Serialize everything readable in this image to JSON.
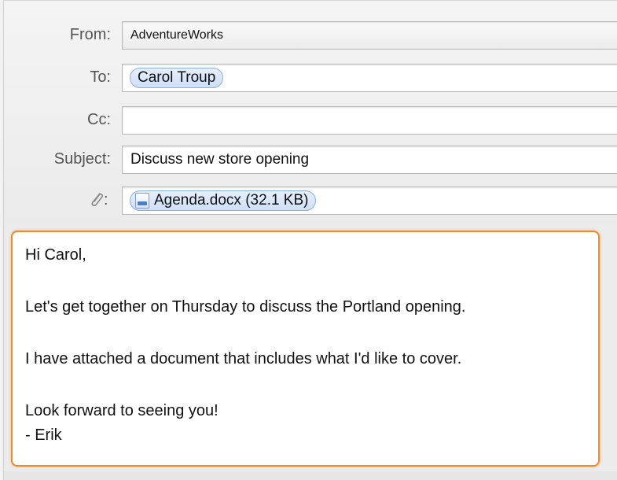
{
  "compose": {
    "from": {
      "label": "From:",
      "value": "AdventureWorks"
    },
    "to": {
      "label": "To:",
      "recipient": "Carol Troup"
    },
    "cc": {
      "label": "Cc:",
      "value": ""
    },
    "subject": {
      "label": "Subject:",
      "value": "Discuss new store opening"
    },
    "attachment": {
      "label_colon": ":",
      "icon": "paperclip-icon",
      "file": "Agenda.docx (32.1 KB)",
      "file_icon": "document-icon"
    }
  },
  "message": {
    "lines": [
      "Hi Carol,",
      "Let's get together on Thursday to discuss the Portland opening.",
      "I have attached a document that includes what I'd like to cover.",
      "Look forward to seeing you!",
      "- Erik"
    ]
  },
  "colors": {
    "focus_ring": "#f08a2b",
    "token_border": "#8eaedb",
    "token_fill": "#d8e6f8"
  }
}
